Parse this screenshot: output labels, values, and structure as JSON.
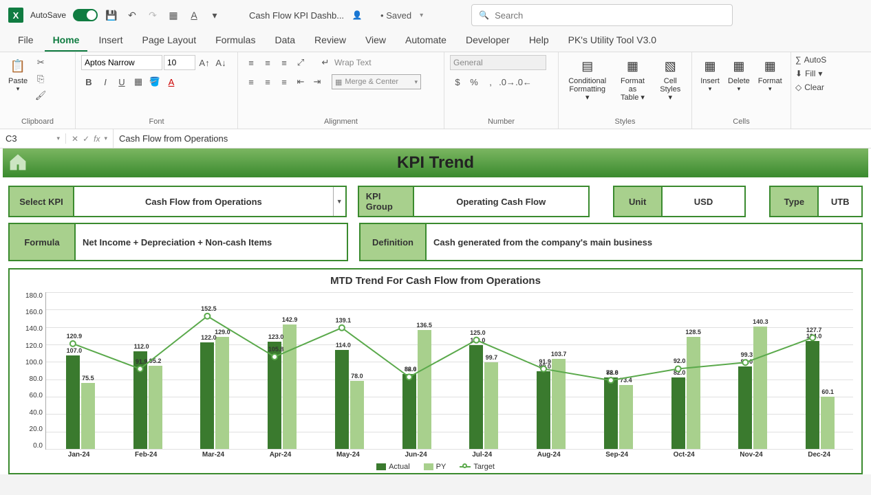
{
  "titlebar": {
    "autosave": "AutoSave",
    "file_name": "Cash Flow KPI Dashb...",
    "saved": "• Saved",
    "search_placeholder": "Search",
    "dropdown_glyph": "▾",
    "on_label": "On"
  },
  "tabs": [
    "File",
    "Home",
    "Insert",
    "Page Layout",
    "Formulas",
    "Data",
    "Review",
    "View",
    "Automate",
    "Developer",
    "Help",
    "PK's Utility Tool V3.0"
  ],
  "active_tab": 1,
  "ribbon": {
    "clipboard": {
      "paste": "Paste",
      "label": "Clipboard"
    },
    "font": {
      "name": "Aptos Narrow",
      "size": "10",
      "label": "Font"
    },
    "alignment": {
      "wrap": "Wrap Text",
      "merge": "Merge & Center",
      "label": "Alignment"
    },
    "number": {
      "format": "General",
      "label": "Number"
    },
    "styles": {
      "cf": "Conditional Formatting",
      "fat": "Format as Table",
      "cs": "Cell Styles",
      "label": "Styles"
    },
    "cells": {
      "insert": "Insert",
      "delete": "Delete",
      "format": "Format",
      "label": "Cells"
    },
    "editing": {
      "autosum": "AutoS",
      "fill": "Fill",
      "clear": "Clear"
    }
  },
  "formula_bar": {
    "cell": "C3",
    "value": "Cash Flow from Operations"
  },
  "sheet": {
    "header": "KPI Trend",
    "select_kpi_label": "Select KPI",
    "select_kpi_value": "Cash Flow from Operations",
    "kpi_group_label": "KPI Group",
    "kpi_group_value": "Operating Cash Flow",
    "unit_label": "Unit",
    "unit_value": "USD",
    "type_label": "Type",
    "type_value": "UTB",
    "formula_label": "Formula",
    "formula_value": "Net Income + Depreciation + Non-cash Items",
    "definition_label": "Definition",
    "definition_value": "Cash generated from the company's main business"
  },
  "chart_data": {
    "type": "bar",
    "title": "MTD Trend For Cash Flow from Operations",
    "ylim": [
      0,
      180
    ],
    "yticks": [
      "180.0",
      "160.0",
      "140.0",
      "120.0",
      "100.0",
      "80.0",
      "60.0",
      "40.0",
      "20.0",
      "0.0"
    ],
    "categories": [
      "Jan-24",
      "Feb-24",
      "Mar-24",
      "Apr-24",
      "May-24",
      "Jun-24",
      "Jul-24",
      "Aug-24",
      "Sep-24",
      "Oct-24",
      "Nov-24",
      "Dec-24"
    ],
    "series": [
      {
        "name": "Actual",
        "values": [
          107.0,
          112.0,
          122.0,
          123.0,
          114.0,
          86.0,
          119.0,
          89.0,
          82.0,
          82.0,
          95.0,
          124.0
        ]
      },
      {
        "name": "PY",
        "values": [
          75.5,
          95.2,
          129.0,
          142.9,
          78.0,
          136.5,
          99.7,
          103.7,
          73.4,
          128.5,
          140.3,
          60.1
        ]
      },
      {
        "name": "Target",
        "values": [
          120.9,
          91.9,
          152.5,
          105.8,
          139.1,
          82.6,
          125.0,
          91.9,
          78.8,
          92.0,
          99.3,
          127.7
        ]
      }
    ],
    "actual_labels": [
      "107.0",
      "112.0",
      "122.0",
      "123.0",
      "114.0",
      "86.0",
      "119.0",
      "89.0",
      "82.0",
      "82.0",
      "95.0",
      "124.0"
    ],
    "py_labels": [
      "75.5",
      "95.2",
      "129.0",
      "142.9",
      "78.0",
      "136.5",
      "99.7",
      "103.7",
      "73.4",
      "128.5",
      "140.3",
      "60.1"
    ],
    "target_labels": [
      "120.9",
      "91.9",
      "152.5",
      "105.8",
      "139.1",
      "82.6",
      "125.0",
      "91.9",
      "78.8",
      "92.0",
      "99.3",
      "127.7"
    ],
    "colors": {
      "actual": "#3a7a2e",
      "py": "#a8d08d",
      "target": "#5aa94b"
    }
  }
}
